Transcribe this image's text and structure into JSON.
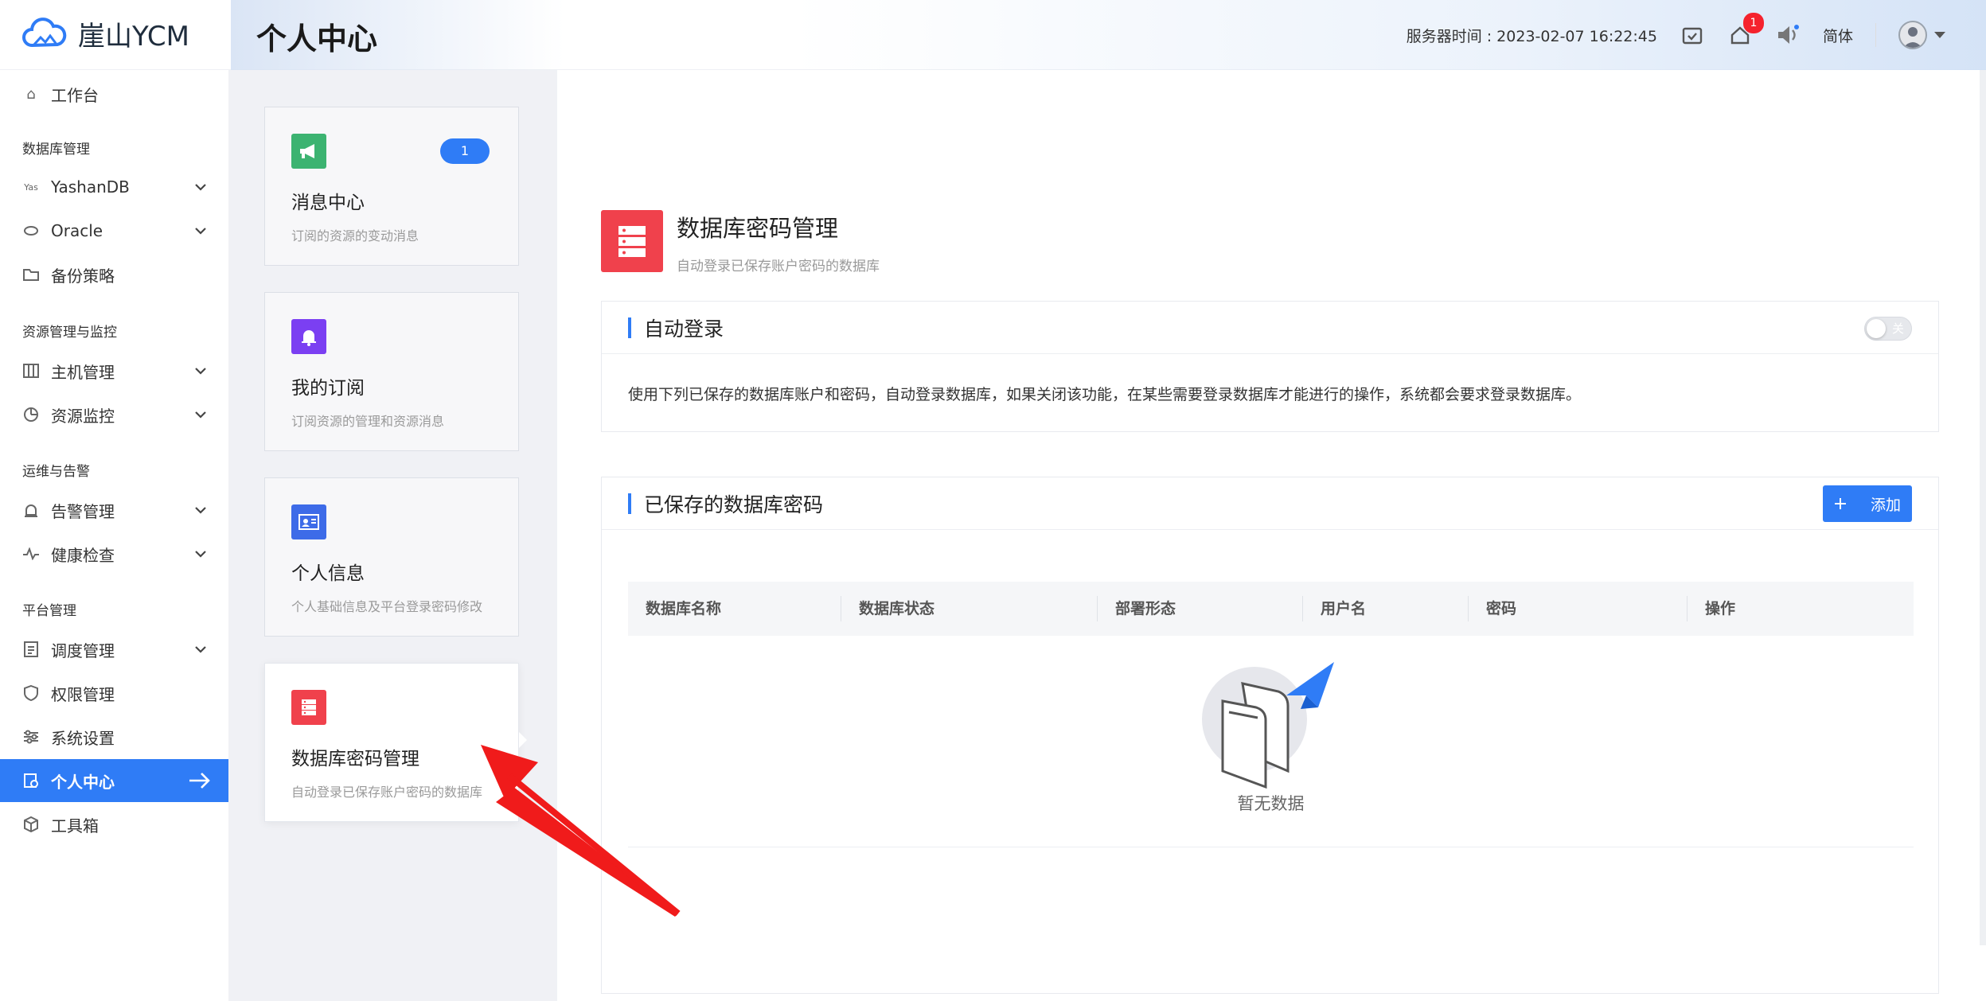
{
  "header": {
    "app_name": "崖山YCM",
    "page_title": "个人中心",
    "server_time": "服务器时间 : 2023-02-07 16:22:45",
    "notification_count": "1",
    "language": "简体"
  },
  "sidebar": {
    "items": [
      {
        "label": "工作台"
      },
      {
        "group": "数据库管理"
      },
      {
        "label": "YashanDB"
      },
      {
        "label": "Oracle"
      },
      {
        "label": "备份策略"
      },
      {
        "group": "资源管理与监控"
      },
      {
        "label": "主机管理"
      },
      {
        "label": "资源监控"
      },
      {
        "group": "运维与告警"
      },
      {
        "label": "告警管理"
      },
      {
        "label": "健康检查"
      },
      {
        "group": "平台管理"
      },
      {
        "label": "调度管理"
      },
      {
        "label": "权限管理"
      },
      {
        "label": "系统设置"
      },
      {
        "label": "个人中心"
      },
      {
        "label": "工具箱"
      }
    ]
  },
  "cards": [
    {
      "title": "消息中心",
      "desc": "订阅的资源的变动消息",
      "badge": "1",
      "color": "#3cb371"
    },
    {
      "title": "我的订阅",
      "desc": "订阅资源的管理和资源消息",
      "color": "#7b3ff2"
    },
    {
      "title": "个人信息",
      "desc": "个人基础信息及平台登录密码修改",
      "color": "#3d6be8"
    },
    {
      "title": "数据库密码管理",
      "desc": "自动登录已保存账户密码的数据库",
      "color": "#f0414c"
    }
  ],
  "main": {
    "title": "数据库密码管理",
    "desc": "自动登录已保存账户密码的数据库",
    "auto_login": {
      "title": "自动登录",
      "toggle_label": "关",
      "toggle_on": false,
      "text": "使用下列已保存的数据库账户和密码，自动登录数据库，如果关闭该功能，在某些需要登录数据库才能进行的操作，系统都会要求登录数据库。"
    },
    "saved": {
      "title": "已保存的数据库密码",
      "add_label": "添加",
      "columns": [
        "数据库名称",
        "数据库状态",
        "部署形态",
        "用户名",
        "密码",
        "操作"
      ],
      "rows": [],
      "empty_text": "暂无数据"
    }
  },
  "colors": {
    "primary": "#2f7cf6",
    "danger": "#f0414c"
  }
}
